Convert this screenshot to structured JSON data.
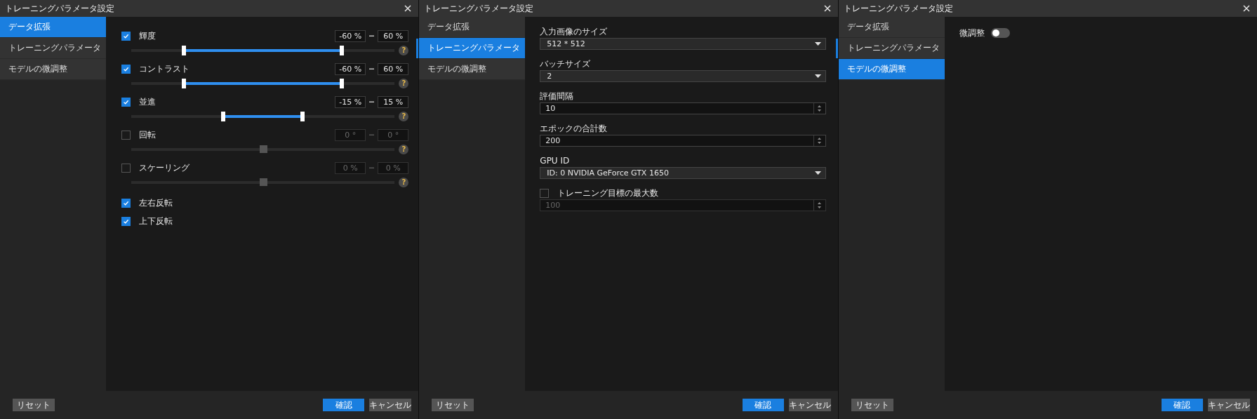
{
  "windows": [
    {
      "title": "トレーニングパラメータ設定",
      "scrollable": true,
      "sidebar": [
        {
          "label": "データ拡張",
          "selected": true
        },
        {
          "label": "トレーニングパラメータ",
          "selected": false
        },
        {
          "label": "モデルの微調整",
          "selected": false
        }
      ],
      "content": {
        "kind": "augmentation",
        "rows": [
          {
            "kind": "range",
            "label": "輝度",
            "checked": true,
            "min": "-60 %",
            "max": "60 %",
            "help": "?",
            "thumbs": [
              {
                "level": 0.2
              },
              {
                "level": 0.8
              }
            ]
          },
          {
            "kind": "range",
            "label": "コントラスト",
            "checked": true,
            "min": "-60 %",
            "max": "60 %",
            "help": "?",
            "thumbs": [
              {
                "level": 0.2
              },
              {
                "level": 0.8
              }
            ]
          },
          {
            "kind": "range",
            "label": "並進",
            "checked": true,
            "min": "-15 %",
            "max": "15 %",
            "help": "?",
            "thumbs": [
              {
                "level": 0.35
              },
              {
                "level": 0.65
              }
            ]
          },
          {
            "kind": "range",
            "label": "回転",
            "checked": false,
            "min": "0 °",
            "max": "0 °",
            "help": "?",
            "thumbs": [
              {
                "level": 0.5
              },
              {
                "level": 0.5
              }
            ]
          },
          {
            "kind": "range",
            "label": "スケーリング",
            "checked": false,
            "min": "0 %",
            "max": "0 %",
            "help": "?",
            "thumbs": [
              {
                "level": 0.5
              },
              {
                "level": 0.5
              }
            ]
          },
          {
            "kind": "check",
            "label": "左右反転",
            "checked": true
          },
          {
            "kind": "check",
            "label": "上下反転",
            "checked": true
          }
        ]
      },
      "footer": {
        "reset": "リセット",
        "confirm": "確認",
        "cancel": "キャンセル"
      }
    },
    {
      "title": "トレーニングパラメータ設定",
      "scrollable": true,
      "sidebar": [
        {
          "label": "データ拡張",
          "selected": false
        },
        {
          "label": "トレーニングパラメータ",
          "selected": true
        },
        {
          "label": "モデルの微調整",
          "selected": false
        }
      ],
      "content": {
        "kind": "training",
        "fields": [
          {
            "kind": "select",
            "label": "入力画像のサイズ",
            "value": "512 * 512"
          },
          {
            "kind": "select",
            "label": "バッチサイズ",
            "value": "2"
          },
          {
            "kind": "spin",
            "label": "評価間隔",
            "value": "10"
          },
          {
            "kind": "spin",
            "label": "エポックの合計数",
            "value": "200"
          },
          {
            "kind": "select",
            "label": "GPU ID",
            "value": "ID: 0  NVIDIA GeForce GTX 1650"
          },
          {
            "kind": "checked_spin",
            "label": "トレーニング目標の最大数",
            "checked": false,
            "value": "100"
          }
        ]
      },
      "footer": {
        "reset": "リセット",
        "confirm": "確認",
        "cancel": "キャンセル"
      }
    },
    {
      "title": "トレーニングパラメータ設定",
      "scrollable": false,
      "sidebar": [
        {
          "label": "データ拡張",
          "selected": false
        },
        {
          "label": "トレーニングパラメータ",
          "selected": false
        },
        {
          "label": "モデルの微調整",
          "selected": true
        }
      ],
      "content": {
        "kind": "finetune",
        "toggle": {
          "label": "微調整",
          "on": false
        }
      },
      "footer": {
        "reset": "リセット",
        "confirm": "確認",
        "cancel": "キャンセル"
      }
    }
  ]
}
